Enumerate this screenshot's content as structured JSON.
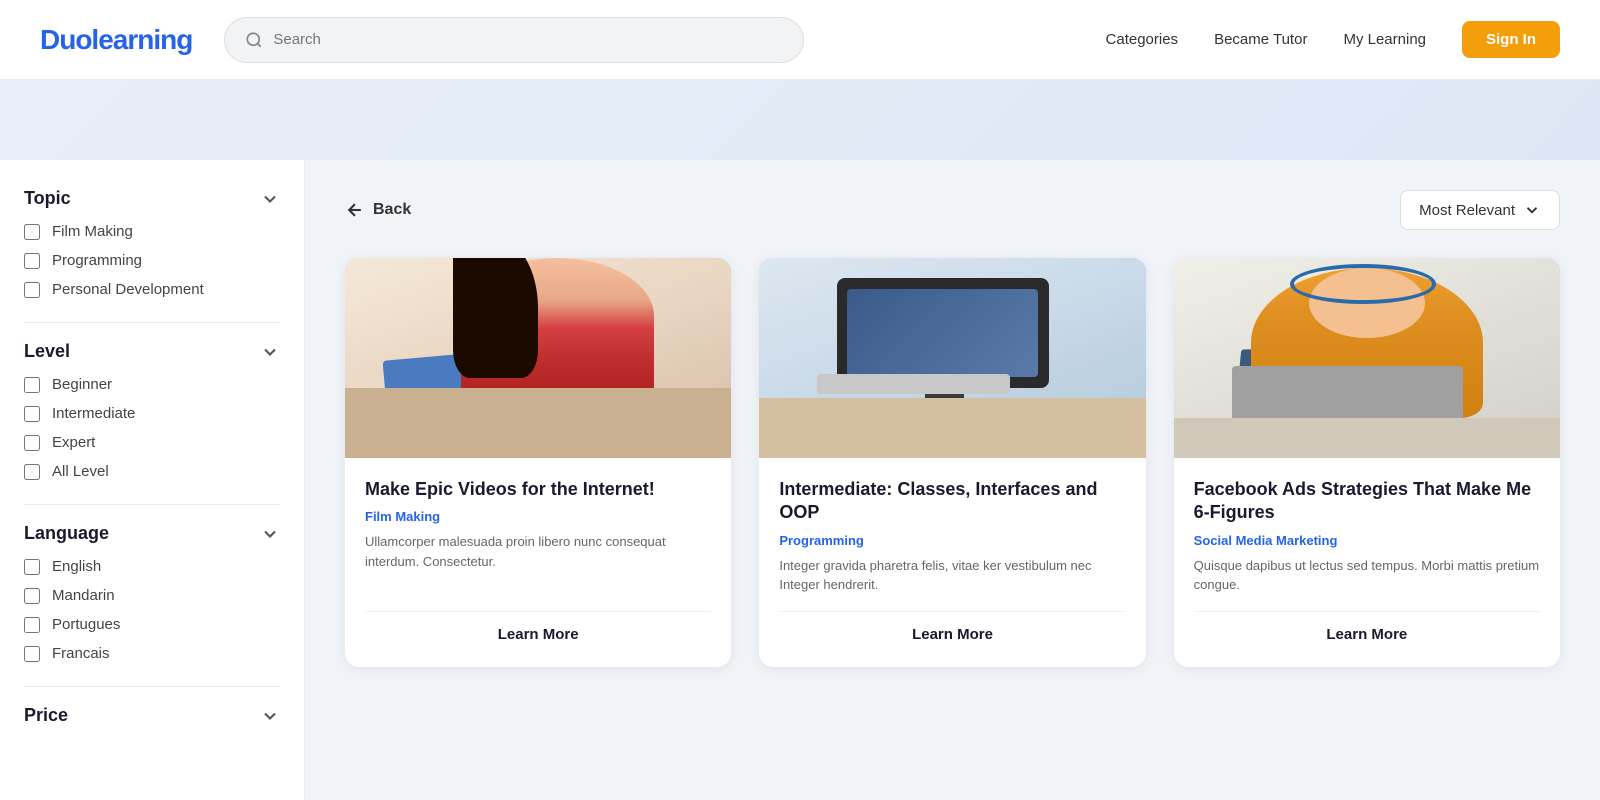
{
  "brand": {
    "logo": "Duolearning"
  },
  "navbar": {
    "search_placeholder": "Search",
    "categories_label": "Categories",
    "become_tutor_label": "Became Tutor",
    "my_learning_label": "My Learning",
    "signin_label": "Sign In"
  },
  "sidebar": {
    "topic_label": "Topic",
    "topic_items": [
      {
        "label": "Film Making",
        "checked": false
      },
      {
        "label": "Programming",
        "checked": false
      },
      {
        "label": "Personal Development",
        "checked": false
      }
    ],
    "level_label": "Level",
    "level_items": [
      {
        "label": "Beginner",
        "checked": false
      },
      {
        "label": "Intermediate",
        "checked": false
      },
      {
        "label": "Expert",
        "checked": false
      },
      {
        "label": "All Level",
        "checked": false
      }
    ],
    "language_label": "Language",
    "language_items": [
      {
        "label": "English",
        "checked": false
      },
      {
        "label": "Mandarin",
        "checked": false
      },
      {
        "label": "Portugues",
        "checked": false
      },
      {
        "label": "Francais",
        "checked": false
      }
    ],
    "price_label": "Price"
  },
  "content": {
    "back_label": "Back",
    "sort_label": "Most Relevant",
    "cards": [
      {
        "title": "Make Epic Videos for the Internet!",
        "category": "Film Making",
        "description": "Ullamcorper malesuada proin libero nunc consequat interdum. Consectetur.",
        "learn_more": "Learn More",
        "scene": "1"
      },
      {
        "title": "Intermediate: Classes, Interfaces and OOP",
        "category": "Programming",
        "description": "Integer gravida pharetra felis, vitae ker vestibulum nec Integer hendrerit.",
        "learn_more": "Learn More",
        "scene": "2"
      },
      {
        "title": "Facebook Ads Strategies That Make Me 6-Figures",
        "category": "Social Media Marketing",
        "description": "Quisque dapibus ut lectus sed tempus. Morbi mattis pretium congue.",
        "learn_more": "Learn More",
        "scene": "3"
      }
    ]
  }
}
